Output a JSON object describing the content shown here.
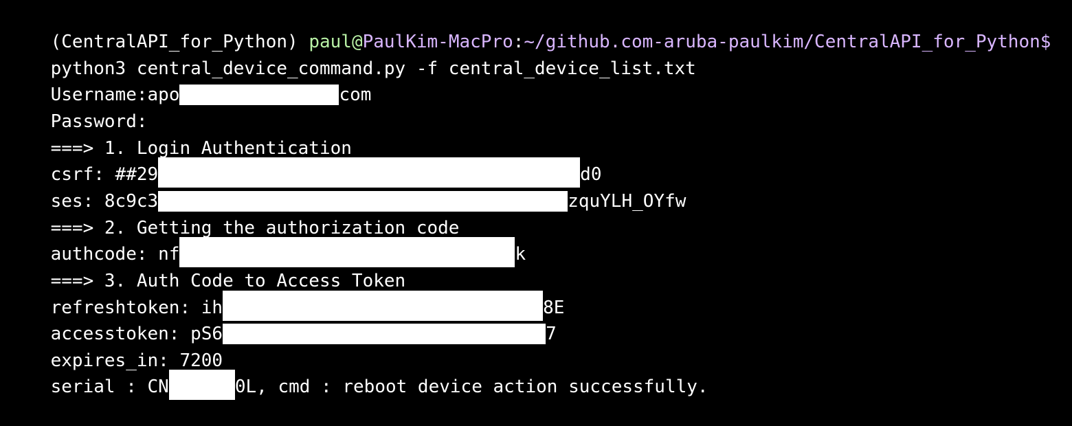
{
  "terminal": {
    "prompt": {
      "env": "(CentralAPI_for_Python) ",
      "user": "paul",
      "at": "@",
      "host": "PaulKim-MacPro",
      "colon": ":",
      "path": "~/github.com-aruba-paulkim/CentralAPI_for_Python$"
    },
    "command": "python3 central_device_command.py -f central_device_list.txt",
    "lines": {
      "username_label": "Username:",
      "username_prefix": "apo",
      "username_suffix": "com",
      "password_label": "Password:",
      "step1": "===> 1. Login Authentication",
      "csrf_label": "csrf: ",
      "csrf_prefix": "##29",
      "csrf_suffix": "d0",
      "ses_label": "ses: ",
      "ses_prefix": "8c9c3",
      "ses_suffix": "zquYLH_OYfw",
      "step2": "===> 2. Getting the authorization code",
      "authcode_label": "authcode: ",
      "authcode_prefix": "nf",
      "authcode_suffix": "k",
      "step3": "===> 3. Auth Code to Access Token",
      "refresh_label": "refreshtoken: ",
      "refresh_prefix": "ih",
      "refresh_suffix": "8E",
      "access_label": "accesstoken: ",
      "access_prefix": "pS6",
      "access_suffix": "7",
      "expires": "expires_in: 7200",
      "serial_label": "serial : ",
      "serial_prefix": "CN",
      "serial_suffix": "0L, cmd : reboot device action successfully."
    },
    "colors": {
      "background": "#000000",
      "text": "#ffffff",
      "user": "#b9f2a6",
      "path": "#d9b6ff",
      "redaction": "#ffffff"
    }
  }
}
